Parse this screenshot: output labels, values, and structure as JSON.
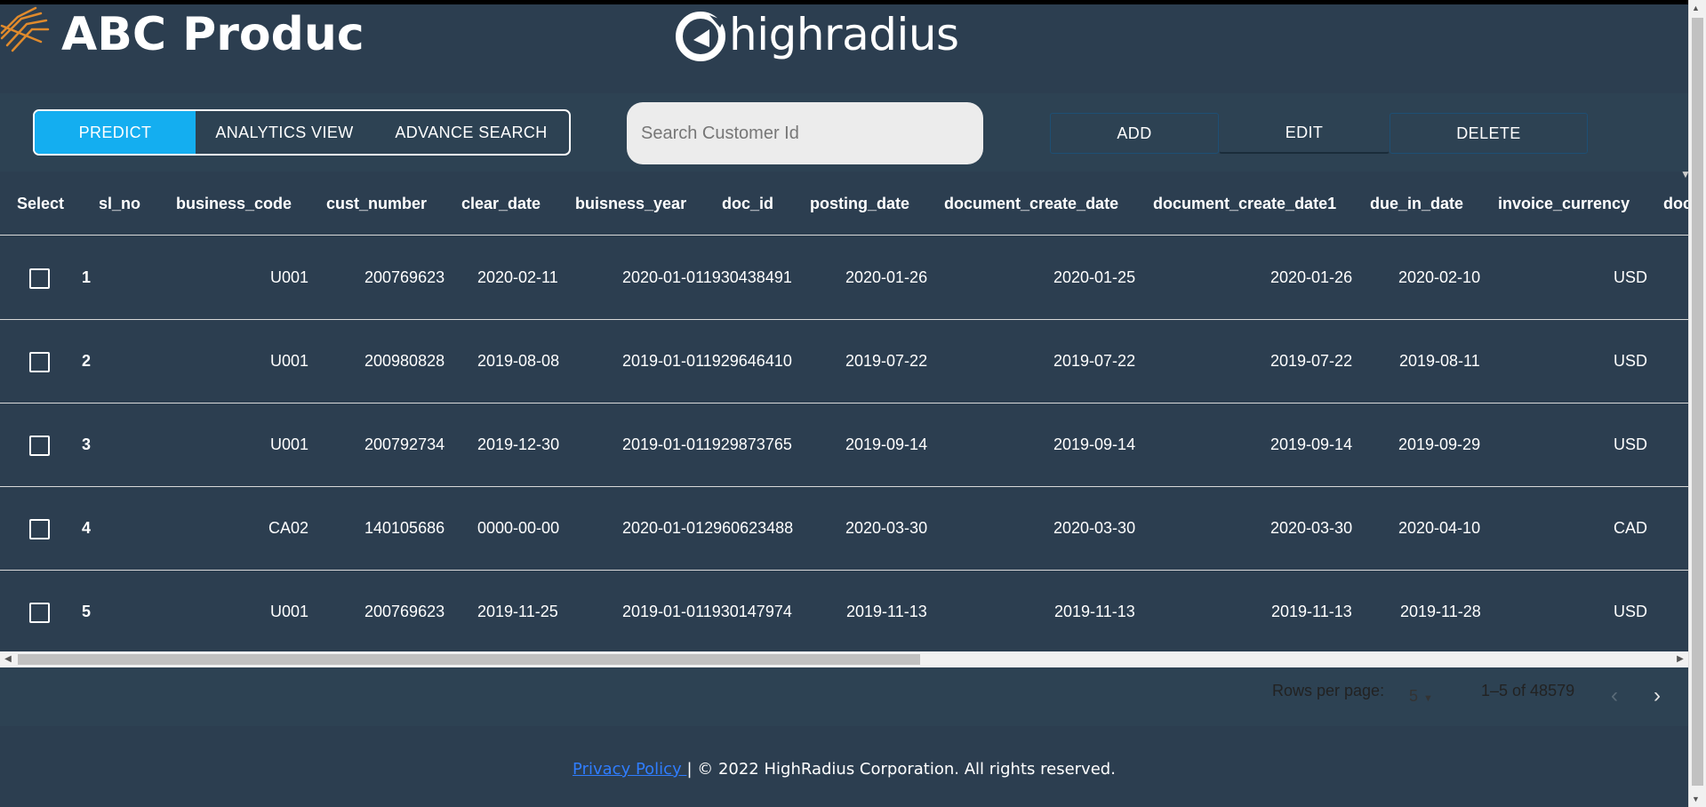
{
  "header": {
    "brand_title": "ABC Produc",
    "hr_logo_text": "highradius",
    "colors": {
      "background": "#2c3e50",
      "logo_orange": "#e08a2c"
    }
  },
  "toolbar": {
    "tabs": [
      {
        "label": "PREDICT",
        "active": true
      },
      {
        "label": "ANALYTICS VIEW",
        "active": false
      },
      {
        "label": "ADVANCE SEARCH",
        "active": false
      }
    ],
    "search_placeholder": "Search Customer Id",
    "search_value": "",
    "add_label": "ADD",
    "edit_label": "EDIT",
    "delete_label": "DELETE",
    "colors": {
      "active_tab": "#14aef0"
    }
  },
  "table": {
    "columns": [
      "Select",
      "sl_no",
      "business_code",
      "cust_number",
      "clear_date",
      "buisness_year",
      "doc_id",
      "posting_date",
      "document_create_date",
      "document_create_date1",
      "due_in_date",
      "invoice_currency",
      "doc"
    ],
    "rows": [
      {
        "sl_no": "1",
        "business_code": "U001",
        "cust_number": "200769623",
        "clear_date": "2020-02-11",
        "buisness_year_doc_id": "2020-01-011930438491",
        "posting_date": "2020-01-26",
        "document_create_date": "2020-01-25",
        "document_create_date1": "2020-01-26",
        "due_in_date": "2020-02-10",
        "invoice_currency": "USD",
        "checked": false
      },
      {
        "sl_no": "2",
        "business_code": "U001",
        "cust_number": "200980828",
        "clear_date": "2019-08-08",
        "buisness_year_doc_id": "2019-01-011929646410",
        "posting_date": "2019-07-22",
        "document_create_date": "2019-07-22",
        "document_create_date1": "2019-07-22",
        "due_in_date": "2019-08-11",
        "invoice_currency": "USD",
        "checked": false
      },
      {
        "sl_no": "3",
        "business_code": "U001",
        "cust_number": "200792734",
        "clear_date": "2019-12-30",
        "buisness_year_doc_id": "2019-01-011929873765",
        "posting_date": "2019-09-14",
        "document_create_date": "2019-09-14",
        "document_create_date1": "2019-09-14",
        "due_in_date": "2019-09-29",
        "invoice_currency": "USD",
        "checked": false
      },
      {
        "sl_no": "4",
        "business_code": "CA02",
        "cust_number": "140105686",
        "clear_date": "0000-00-00",
        "buisness_year_doc_id": "2020-01-012960623488",
        "posting_date": "2020-03-30",
        "document_create_date": "2020-03-30",
        "document_create_date1": "2020-03-30",
        "due_in_date": "2020-04-10",
        "invoice_currency": "CAD",
        "checked": false
      },
      {
        "sl_no": "5",
        "business_code": "U001",
        "cust_number": "200769623",
        "clear_date": "2019-11-25",
        "buisness_year_doc_id": "2019-01-011930147974",
        "posting_date": "2019-11-13",
        "document_create_date": "2019-11-13",
        "document_create_date1": "2019-11-13",
        "due_in_date": "2019-11-28",
        "invoice_currency": "USD",
        "checked": false
      }
    ]
  },
  "pagination": {
    "rows_per_page_label": "Rows per page:",
    "rows_per_page_value": "5",
    "range_text": "1–5 of 48579",
    "prev_icon": "chevron-left-icon",
    "next_icon": "chevron-right-icon"
  },
  "footer": {
    "privacy_link": "Privacy Policy ",
    "copyright": "| © 2022 HighRadius Corporation. All rights reserved."
  }
}
